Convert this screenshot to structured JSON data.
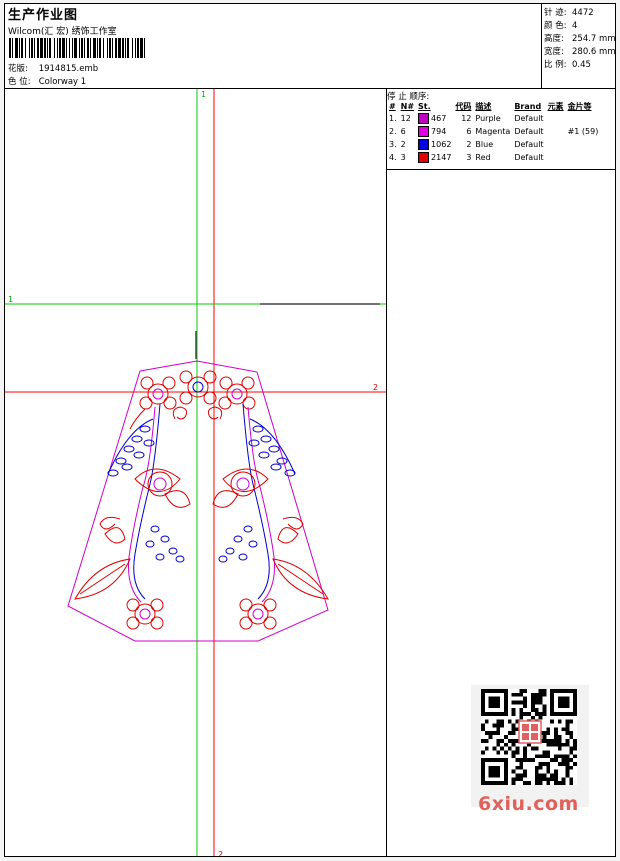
{
  "header": {
    "title": "生产作业图",
    "company": "Wilcom(汇 宏) 绣饰工作室",
    "design_label": "花版:",
    "design_value": "1914815.emb",
    "colorway_label": "色 位:",
    "colorway_value": "Colorway 1"
  },
  "stats": [
    {
      "label": "针 迹:",
      "value": "4472"
    },
    {
      "label": "颜 色:",
      "value": "4"
    },
    {
      "label": "高度:",
      "value": "254.7 mm"
    },
    {
      "label": "宽度:",
      "value": "280.6 mm"
    },
    {
      "label": "比 例:",
      "value": "0.45"
    }
  ],
  "sequence": {
    "title": "停 止 顺序:",
    "headers": [
      "#",
      "N#",
      "St.",
      "代码",
      "描述",
      "Brand",
      "元素",
      "金片等"
    ],
    "rows": [
      {
        "idx": "1.",
        "n": "12",
        "color": "#c000c0",
        "st": "467",
        "code": "12",
        "desc": "Purple",
        "brand": "Default",
        "elem": "",
        "seq": ""
      },
      {
        "idx": "2.",
        "n": "6",
        "color": "#e000e0",
        "st": "794",
        "code": "6",
        "desc": "Magenta",
        "brand": "Default",
        "elem": "",
        "seq": "#1 (59)"
      },
      {
        "idx": "3.",
        "n": "2",
        "color": "#0000e0",
        "st": "1062",
        "code": "2",
        "desc": "Blue",
        "brand": "Default",
        "elem": "",
        "seq": ""
      },
      {
        "idx": "4.",
        "n": "3",
        "color": "#e00000",
        "st": "2147",
        "code": "3",
        "desc": "Red",
        "brand": "Default",
        "elem": "",
        "seq": ""
      }
    ]
  },
  "guides": {
    "v1_label": "1",
    "h1_label": "1",
    "h2_label": "2",
    "v2_label": "2",
    "green": "#00cc00",
    "red": "#ff0000"
  },
  "watermark": "6xiu.com",
  "stamp_icon": "seal-stamp-icon"
}
